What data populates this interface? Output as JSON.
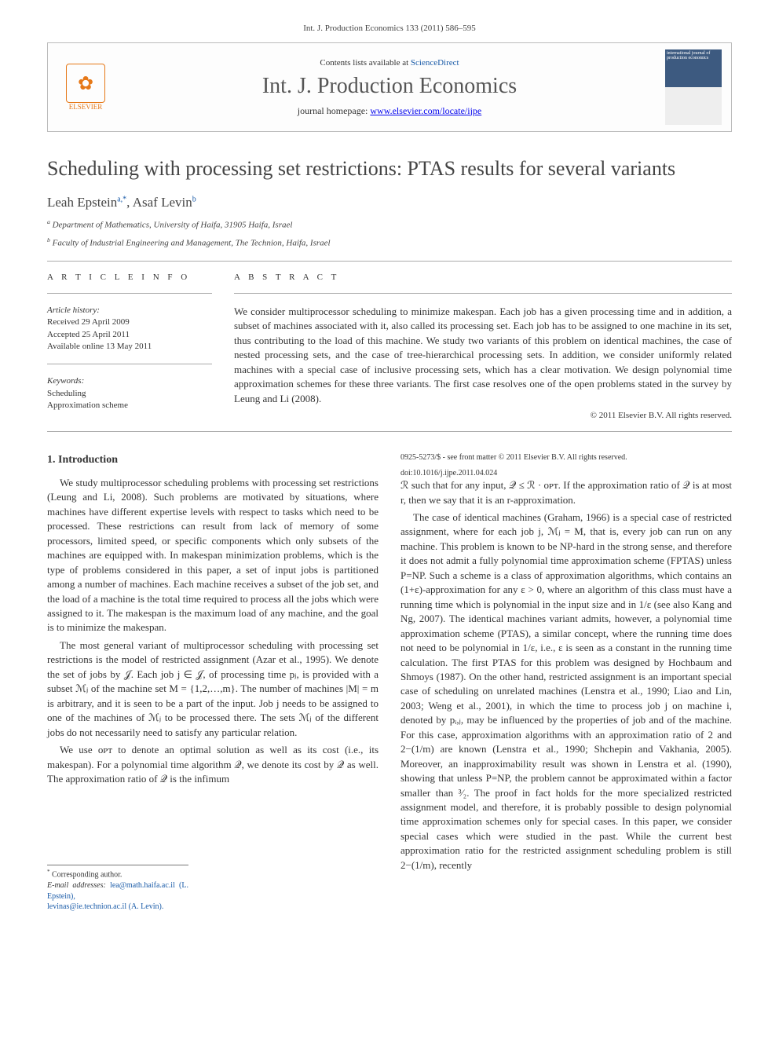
{
  "journal_ref": "Int. J. Production Economics 133 (2011) 586–595",
  "header": {
    "contents_prefix": "Contents lists available at",
    "contents_link": "ScienceDirect",
    "journal_title": "Int. J. Production Economics",
    "homepage_prefix": "journal homepage:",
    "homepage_url": "www.elsevier.com/locate/ijpe",
    "publisher": "ELSEVIER",
    "cover_text": "international journal of production economics"
  },
  "article": {
    "title": "Scheduling with processing set restrictions: PTAS results for several variants",
    "authors_line_pre": "Leah Epstein",
    "authors_sup_a": "a,",
    "authors_star": "*",
    "authors_sep": ", ",
    "authors_line_post": "Asaf Levin",
    "authors_sup_b": "b",
    "affil_a": "Department of Mathematics, University of Haifa, 31905 Haifa, Israel",
    "affil_b": "Faculty of Industrial Engineering and Management, The Technion, Haifa, Israel"
  },
  "info": {
    "label": "A R T I C L E   I N F O",
    "history_label": "Article history:",
    "received": "Received 29 April 2009",
    "accepted": "Accepted 25 April 2011",
    "online": "Available online 13 May 2011",
    "keywords_label": "Keywords:",
    "kw1": "Scheduling",
    "kw2": "Approximation scheme"
  },
  "abstract": {
    "label": "A B S T R A C T",
    "text": "We consider multiprocessor scheduling to minimize makespan. Each job has a given processing time and in addition, a subset of machines associated with it, also called its processing set. Each job has to be assigned to one machine in its set, thus contributing to the load of this machine. We study two variants of this problem on identical machines, the case of nested processing sets, and the case of tree-hierarchical processing sets. In addition, we consider uniformly related machines with a special case of inclusive processing sets, which has a clear motivation. We design polynomial time approximation schemes for these three variants. The first case resolves one of the open problems stated in the survey by Leung and Li (2008).",
    "copyright": "© 2011 Elsevier B.V. All rights reserved."
  },
  "body": {
    "heading1": "1. Introduction",
    "p1": "We study multiprocessor scheduling problems with processing set restrictions (Leung and Li, 2008). Such problems are motivated by situations, where machines have different expertise levels with respect to tasks which need to be processed. These restrictions can result from lack of memory of some processors, limited speed, or specific components which only subsets of the machines are equipped with. In makespan minimization problems, which is the type of problems considered in this paper, a set of input jobs is partitioned among a number of machines. Each machine receives a subset of the job set, and the load of a machine is the total time required to process all the jobs which were assigned to it. The makespan is the maximum load of any machine, and the goal is to minimize the makespan.",
    "p2": "The most general variant of multiprocessor scheduling with processing set restrictions is the model of restricted assignment (Azar et al., 1995). We denote the set of jobs by 𝒥. Each job j ∈ 𝒥, of processing time pⱼ, is provided with a subset ℳⱼ of the machine set M = {1,2,…,m}. The number of machines |M| = m is arbitrary, and it is seen to be a part of the input. Job j needs to be assigned to one of the machines of ℳⱼ to be processed there. The sets ℳⱼ of the different jobs do not necessarily need to satisfy any particular relation.",
    "p3": "We use ᴏᴘᴛ to denote an optimal solution as well as its cost (i.e., its makespan). For a polynomial time algorithm 𝒬, we denote its cost by 𝒬 as well. The approximation ratio of 𝒬 is the infimum",
    "p4": "ℛ such that for any input, 𝒬 ≤ ℛ · ᴏᴘᴛ. If the approximation ratio of 𝒬 is at most r, then we say that it is an r-approximation.",
    "p5": "The case of identical machines (Graham, 1966) is a special case of restricted assignment, where for each job j, ℳⱼ = M, that is, every job can run on any machine. This problem is known to be NP-hard in the strong sense, and therefore it does not admit a fully polynomial time approximation scheme (FPTAS) unless P=NP. Such a scheme is a class of approximation algorithms, which contains an (1+ε)-approximation for any ε > 0, where an algorithm of this class must have a running time which is polynomial in the input size and in 1/ε (see also Kang and Ng, 2007). The identical machines variant admits, however, a polynomial time approximation scheme (PTAS), a similar concept, where the running time does not need to be polynomial in 1/ε, i.e., ε is seen as a constant in the running time calculation. The first PTAS for this problem was designed by Hochbaum and Shmoys (1987). On the other hand, restricted assignment is an important special case of scheduling on unrelated machines (Lenstra et al., 1990; Liao and Lin, 2003; Weng et al., 2001), in which the time to process job j on machine i, denoted by pᵢ,ⱼ, may be influenced by the properties of job and of the machine. For this case, approximation algorithms with an approximation ratio of 2 and 2−(1/m) are known (Lenstra et al., 1990; Shchepin and Vakhania, 2005). Moreover, an inapproximability result was shown in Lenstra et al. (1990), showing that unless P=NP, the problem cannot be approximated within a factor smaller than ³⁄₂. The proof in fact holds for the more specialized restricted assignment model, and therefore, it is probably possible to design polynomial time approximation schemes only for special cases. In this paper, we consider special cases which were studied in the past. While the current best approximation ratio for the restricted assignment scheduling problem is still 2−(1/m), recently"
  },
  "footnotes": {
    "corresponding": "Corresponding author.",
    "email_label": "E-mail addresses:",
    "email1": "lea@math.haifa.ac.il (L. Epstein),",
    "email2": "levinas@ie.technion.ac.il (A. Levin)."
  },
  "footer": {
    "issn": "0925-5273/$ - see front matter © 2011 Elsevier B.V. All rights reserved.",
    "doi": "doi:10.1016/j.ijpe.2011.04.024"
  }
}
